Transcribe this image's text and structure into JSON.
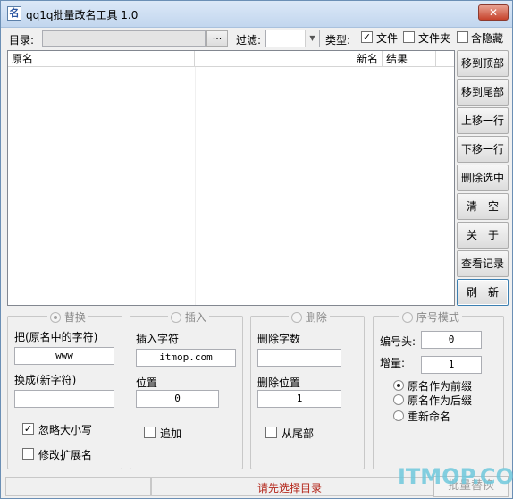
{
  "window": {
    "title": "qq1q批量改名工具 1.0",
    "icon_glyph": "名",
    "close_label": "✕"
  },
  "toolbar": {
    "dir_label": "目录:",
    "dir_value": "",
    "browse_label": "...",
    "filter_label": "过滤:",
    "filter_value": "",
    "type_label": "类型:",
    "type_file": "文件",
    "type_folder": "文件夹",
    "type_hidden": "含隐藏",
    "type_file_checked": true,
    "type_folder_checked": false,
    "type_hidden_checked": false
  },
  "list": {
    "columns": [
      "原名",
      "新名",
      "结果"
    ],
    "rows": []
  },
  "side_buttons": [
    "移到顶部",
    "移到尾部",
    "上移一行",
    "下移一行",
    "删除选中",
    "清　空",
    "关　于",
    "查看记录",
    "刷　新"
  ],
  "replace": {
    "legend": "替换",
    "selected": true,
    "find_label": "把(原名中的字符)",
    "find_value": "www",
    "replace_label": "换成(新字符)",
    "replace_value": "",
    "ignore_case_label": "忽略大小写",
    "ignore_case_checked": true,
    "modify_ext_label": "修改扩展名",
    "modify_ext_checked": false
  },
  "insert": {
    "legend": "插入",
    "selected": false,
    "text_label": "插入字符",
    "text_value": "itmop.com",
    "pos_label": "位置",
    "pos_value": "0",
    "append_label": "追加",
    "append_checked": false
  },
  "delete": {
    "legend": "删除",
    "selected": false,
    "count_label": "删除字数",
    "count_value": "",
    "pos_label": "删除位置",
    "pos_value": "1",
    "from_end_label": "从尾部",
    "from_end_checked": false
  },
  "sequence": {
    "legend": "序号模式",
    "selected": false,
    "prefix_label": "编号头:",
    "prefix_value": "0",
    "increment_label": "增量:",
    "increment_value": "1",
    "options": [
      "原名作为前缀",
      "原名作为后缀",
      "重新命名"
    ],
    "selected_option": 0
  },
  "status": {
    "message": "请先选择目录",
    "batch_button": "批量替换"
  },
  "watermark": "ITMOP.COM"
}
